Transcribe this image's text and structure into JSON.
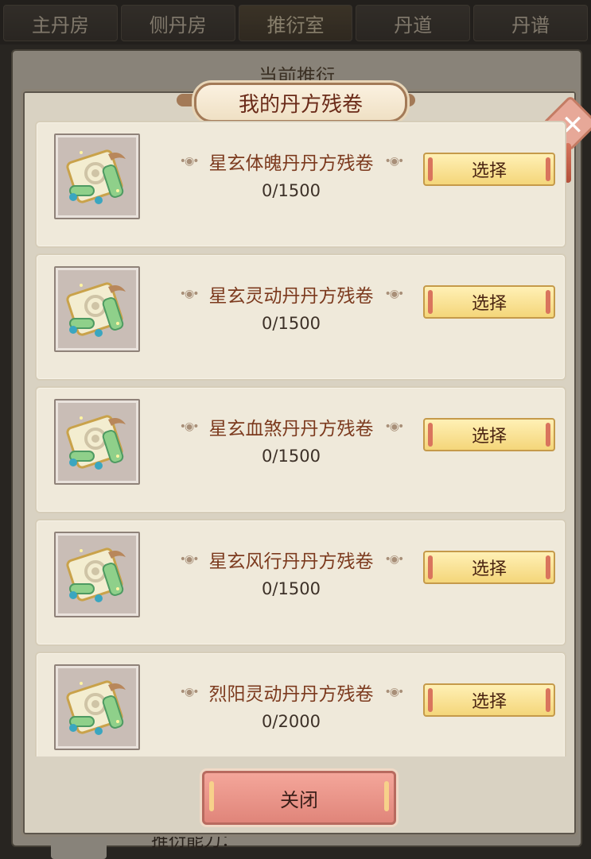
{
  "tabs": [
    {
      "label": "主丹房"
    },
    {
      "label": "侧丹房"
    },
    {
      "label": "推衍室"
    },
    {
      "label": "丹道"
    },
    {
      "label": "丹谱"
    }
  ],
  "background": {
    "title": "当前推衍",
    "bottom_text": "推衍能力："
  },
  "modal": {
    "title": "我的丹方残卷",
    "close_label": "关闭"
  },
  "items": [
    {
      "name": "星玄体魄丹丹方残卷",
      "count": "0/1500",
      "button": "选择",
      "icon": "scroll-icon"
    },
    {
      "name": "星玄灵动丹丹方残卷",
      "count": "0/1500",
      "button": "选择",
      "icon": "scroll-icon"
    },
    {
      "name": "星玄血煞丹丹方残卷",
      "count": "0/1500",
      "button": "选择",
      "icon": "scroll-icon"
    },
    {
      "name": "星玄风行丹丹方残卷",
      "count": "0/1500",
      "button": "选择",
      "icon": "scroll-icon"
    },
    {
      "name": "烈阳灵动丹丹方残卷",
      "count": "0/2000",
      "button": "选择",
      "icon": "scroll-icon"
    }
  ],
  "colors": {
    "item_name": "#7c3a1e",
    "select_button": "#f4d67a",
    "close_button": "#e0857a"
  }
}
